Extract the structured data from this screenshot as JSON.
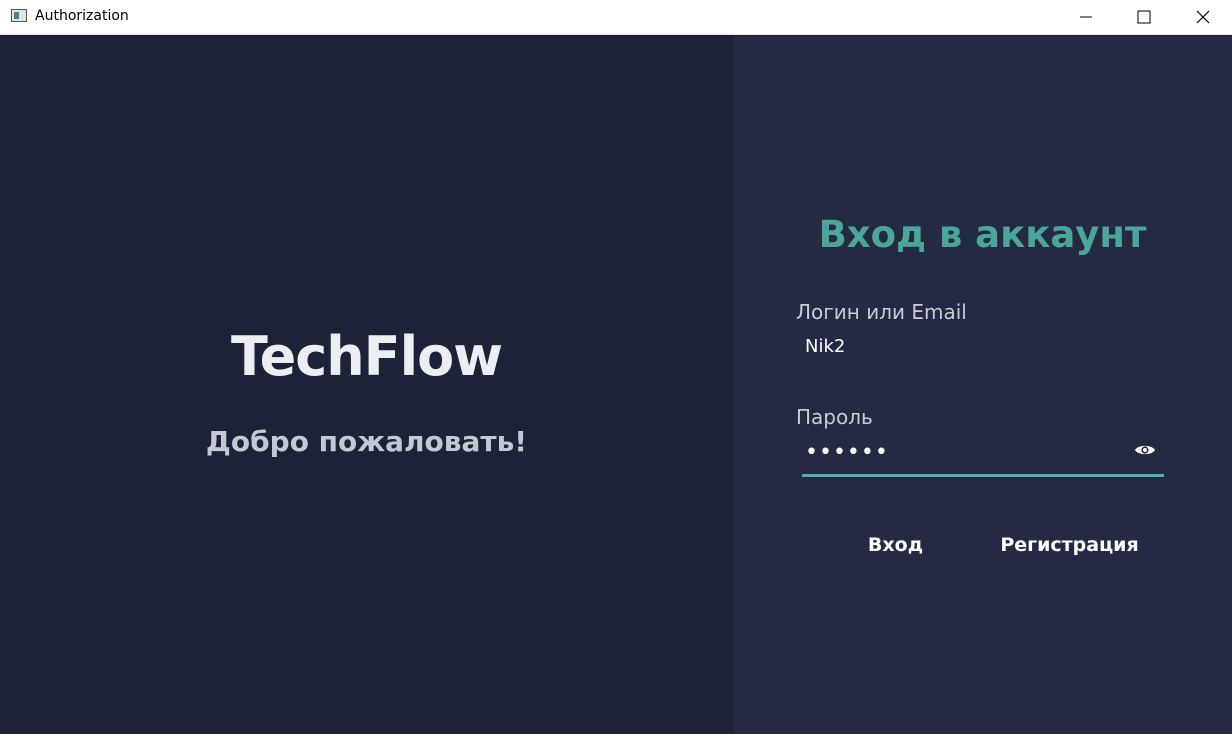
{
  "window": {
    "title": "Authorization"
  },
  "left": {
    "brand": "TechFlow",
    "welcome": "Добро пожаловать!"
  },
  "form": {
    "title": "Вход в аккаунт",
    "login_label": "Логин или Email",
    "login_value": "Nik2",
    "password_label": "Пароль",
    "password_value": "••••••",
    "login_button": "Вход",
    "register_button": "Регистрация"
  },
  "icons": {
    "app": "app-window-icon",
    "minimize": "minimize-icon",
    "maximize": "maximize-icon",
    "close": "close-icon",
    "show_password": "eye-icon"
  },
  "colors": {
    "left_bg": "#1c2338",
    "right_bg": "#252a44",
    "accent": "#4aa69a",
    "underline": "#4fb0a5"
  }
}
